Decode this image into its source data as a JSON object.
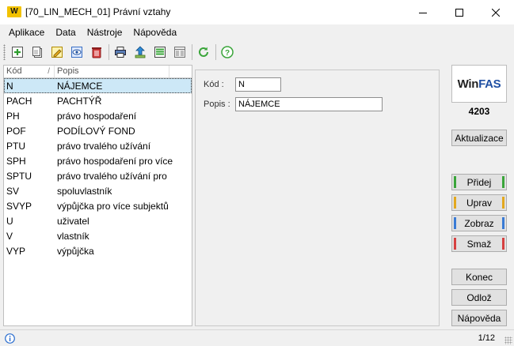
{
  "window": {
    "logo_text": "W",
    "title": "[70_LIN_MECH_01] Právní vztahy"
  },
  "menu": [
    "Aplikace",
    "Data",
    "Nástroje",
    "Nápověda"
  ],
  "grid": {
    "col_code": "Kód",
    "sort_indicator": "/",
    "col_desc": "Popis",
    "rows": [
      {
        "code": "N",
        "desc": "NÁJEMCE"
      },
      {
        "code": "PACH",
        "desc": "PACHTÝŘ"
      },
      {
        "code": "PH",
        "desc": "právo hospodaření"
      },
      {
        "code": "POF",
        "desc": "PODÍLOVÝ FOND"
      },
      {
        "code": "PTU",
        "desc": "právo trvalého užívání"
      },
      {
        "code": "SPH",
        "desc": "právo hospodaření pro více"
      },
      {
        "code": "SPTU",
        "desc": "právo trvalého užívání pro"
      },
      {
        "code": "SV",
        "desc": "spoluvlastník"
      },
      {
        "code": "SVYP",
        "desc": "výpůjčka pro více subjektů"
      },
      {
        "code": "U",
        "desc": "uživatel"
      },
      {
        "code": "V",
        "desc": "vlastník"
      },
      {
        "code": "VYP",
        "desc": "výpůjčka"
      }
    ]
  },
  "detail": {
    "code_label": "Kód :",
    "code_value": "N",
    "desc_label": "Popis :",
    "desc_value": "NÁJEMCE"
  },
  "brand": {
    "name_a": "Win",
    "name_b": "FAS",
    "number": "4203"
  },
  "buttons": {
    "refresh": "Aktualizace",
    "add": "Přidej",
    "edit": "Uprav",
    "view": "Zobraz",
    "delete": "Smaž",
    "end": "Konec",
    "postpone": "Odlož",
    "help": "Nápověda"
  },
  "colors": {
    "add": "#3aa53a",
    "edit": "#e3a81e",
    "view": "#3a7bd5",
    "delete": "#d64040",
    "selection": "#cde8f7"
  },
  "status": {
    "page": "1/12"
  }
}
